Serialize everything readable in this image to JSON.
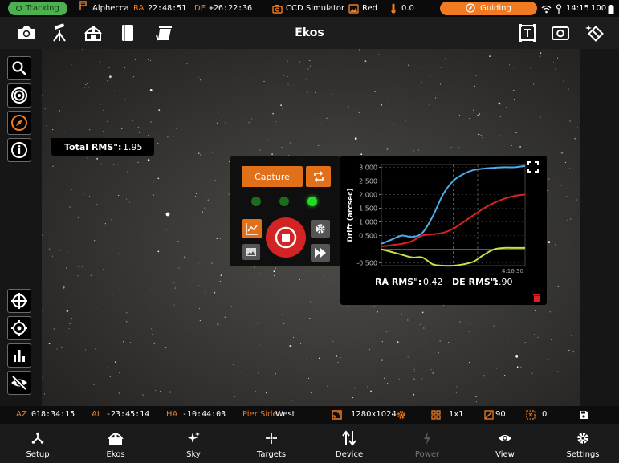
{
  "status_bar": {
    "tracking": "Tracking",
    "target": "Alphecca",
    "ra_label": "RA",
    "ra_value": "22:48:51",
    "de_label": "DE",
    "de_value": "+26:22:36",
    "camera": "CCD Simulator",
    "filter": "Red",
    "temperature": "0.0",
    "guiding": "Guiding",
    "time": "14:15",
    "battery": "100"
  },
  "toolbar": {
    "title": "Ekos",
    "left_icons": [
      "camera-icon",
      "mount-icon",
      "observatory-icon",
      "notebook-icon",
      "flat-panel-icon"
    ],
    "right_icons": [
      "text-frame-icon",
      "capture-preview-icon",
      "auto-detect-icon"
    ]
  },
  "left_rail": {
    "top_buttons": [
      "search-icon",
      "target-icon",
      "compass-icon",
      "info-icon"
    ],
    "bottom_buttons": [
      "crosshair-icon",
      "center-icon",
      "histogram-icon",
      "hide-icon"
    ]
  },
  "guide_panel": {
    "capture_label": "Capture",
    "leds": [
      "#1e6b1e",
      "#1e6b1e",
      "#22dd22"
    ]
  },
  "drift": {
    "ylabel": "Drift (arcsec)",
    "y_ticks": [
      "3.000",
      "2.500",
      "2.000",
      "1.500",
      "1.000",
      "0.500",
      "-0.500"
    ],
    "x_tick_time": "4:16:30",
    "ra_rms_label": "RA RMS\":",
    "ra_rms_value": "0.42",
    "de_rms_label": "DE RMS\":",
    "de_rms_value": "1.90",
    "total_rms_label": "Total RMS\":",
    "total_rms_value": "1.95"
  },
  "chart_data": {
    "type": "line",
    "ylabel": "Drift (arcsec)",
    "ylim": [
      -0.6,
      3.1
    ],
    "x": [
      0,
      1,
      2,
      3,
      4,
      5,
      6,
      7,
      8,
      9,
      10,
      11,
      12,
      13,
      14
    ],
    "series": [
      {
        "color": "#4aaee8",
        "values": [
          0.2,
          0.35,
          0.5,
          0.45,
          0.6,
          1.2,
          2.0,
          2.5,
          2.75,
          2.9,
          2.95,
          2.98,
          3.0,
          3.0,
          3.05
        ]
      },
      {
        "color": "#e02020",
        "values": [
          0.1,
          0.15,
          0.2,
          0.3,
          0.5,
          0.55,
          0.6,
          0.75,
          1.0,
          1.25,
          1.5,
          1.7,
          1.85,
          1.95,
          2.0
        ]
      },
      {
        "color": "#c8e04a",
        "values": [
          0.0,
          -0.1,
          -0.2,
          -0.3,
          -0.3,
          -0.55,
          -0.6,
          -0.6,
          -0.55,
          -0.45,
          -0.2,
          0.0,
          0.05,
          0.05,
          0.05
        ]
      }
    ]
  },
  "info_bar": {
    "az_label": "AZ",
    "az_value": "018:34:15",
    "al_label": "AL",
    "al_value": "-23:45:14",
    "ha_label": "HA",
    "ha_value": "-10:44:03",
    "pier_label": "Pier Side",
    "pier_value": "West",
    "resolution": "1280x1024",
    "binning": "1x1",
    "exposure": "90",
    "count": "0"
  },
  "bottom_nav": [
    {
      "label": "Setup",
      "icon": "setup-icon"
    },
    {
      "label": "Ekos",
      "icon": "ekos-icon"
    },
    {
      "label": "Sky",
      "icon": "sky-icon"
    },
    {
      "label": "Targets",
      "icon": "targets-icon"
    },
    {
      "label": "Device",
      "icon": "device-icon"
    },
    {
      "label": "Power",
      "icon": "power-icon"
    },
    {
      "label": "View",
      "icon": "view-icon"
    },
    {
      "label": "Settings",
      "icon": "settings-icon"
    }
  ],
  "colors": {
    "accent": "#f07b22",
    "tracking": "#4caf50",
    "stop": "#d32323"
  }
}
